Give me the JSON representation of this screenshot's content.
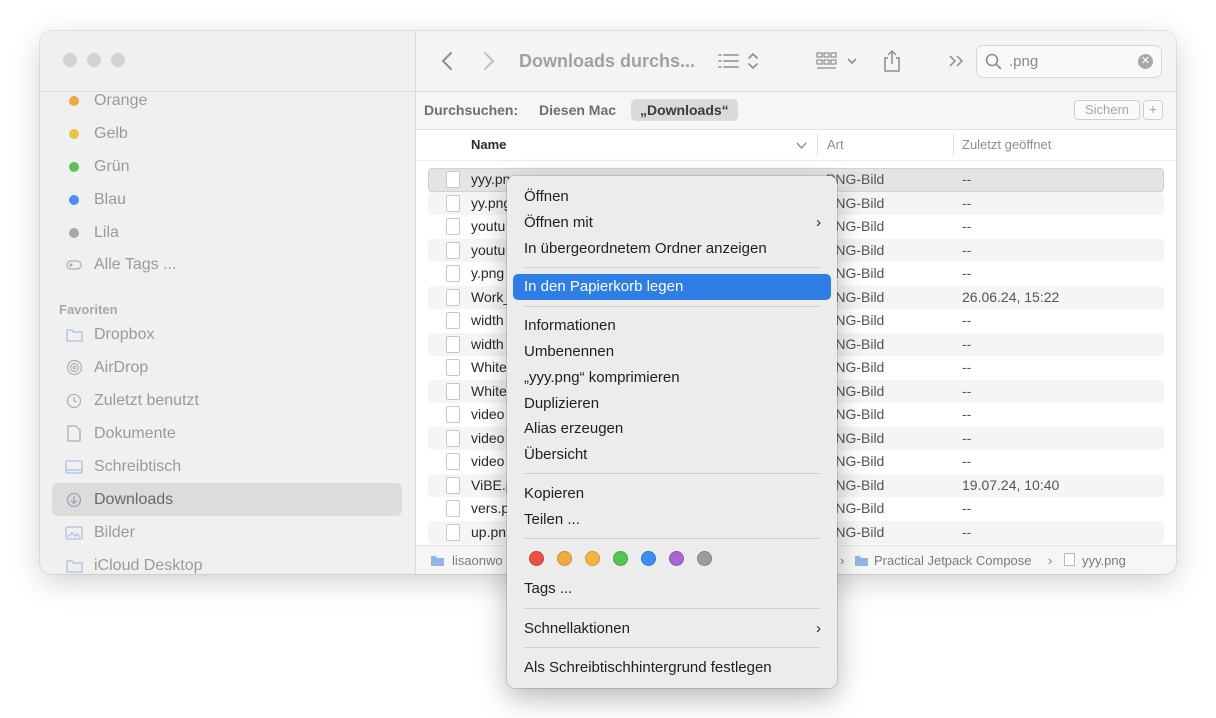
{
  "sidebar": {
    "tags": [
      {
        "label": "Orange",
        "color": "#f0a74a"
      },
      {
        "label": "Gelb",
        "color": "#e8c443"
      },
      {
        "label": "Grün",
        "color": "#5cbf5a"
      },
      {
        "label": "Blau",
        "color": "#4f8ef0"
      },
      {
        "label": "Lila",
        "color": "#a8a8a8"
      }
    ],
    "all_tags": "Alle Tags ...",
    "favorites_heading": "Favoriten",
    "favorites": [
      {
        "label": "Dropbox",
        "icon": "folder-icon"
      },
      {
        "label": "AirDrop",
        "icon": "airdrop-icon"
      },
      {
        "label": "Zuletzt benutzt",
        "icon": "clock-icon"
      },
      {
        "label": "Dokumente",
        "icon": "document-icon"
      },
      {
        "label": "Schreibtisch",
        "icon": "desktop-icon"
      },
      {
        "label": "Downloads",
        "icon": "download-icon"
      },
      {
        "label": "Bilder",
        "icon": "photo-icon"
      },
      {
        "label": "iCloud Desktop",
        "icon": "folder-icon"
      }
    ]
  },
  "toolbar": {
    "title": "Downloads durchs...",
    "search_value": ".png"
  },
  "scopebar": {
    "label": "Durchsuchen:",
    "this_mac": "Diesen Mac",
    "downloads": "„Downloads“",
    "save": "Sichern",
    "add": "+"
  },
  "columns": {
    "name": "Name",
    "kind": "Art",
    "opened": "Zuletzt geöffnet"
  },
  "files": [
    {
      "name": "yyy.png",
      "kind": "PNG-Bild",
      "opened": "--"
    },
    {
      "name": "yy.png",
      "kind": "PNG-Bild",
      "opened": "--"
    },
    {
      "name": "youtu",
      "kind": "PNG-Bild",
      "opened": "--"
    },
    {
      "name": "youtu",
      "kind": "PNG-Bild",
      "opened": "--"
    },
    {
      "name": "y.png",
      "kind": "PNG-Bild",
      "opened": "--"
    },
    {
      "name": "Work_",
      "kind": "PNG-Bild",
      "opened": "26.06.24, 15:22"
    },
    {
      "name": "width",
      "kind": "PNG-Bild",
      "opened": "--"
    },
    {
      "name": "width",
      "kind": "PNG-Bild",
      "opened": "--"
    },
    {
      "name": "White",
      "kind": "PNG-Bild",
      "opened": "--"
    },
    {
      "name": "White",
      "kind": "PNG-Bild",
      "opened": "--"
    },
    {
      "name": "video",
      "kind": "PNG-Bild",
      "opened": "--"
    },
    {
      "name": "video",
      "kind": "PNG-Bild",
      "opened": "--"
    },
    {
      "name": "video",
      "kind": "PNG-Bild",
      "opened": "--"
    },
    {
      "name": "ViBE.p",
      "kind": "PNG-Bild",
      "opened": "19.07.24, 10:40"
    },
    {
      "name": "vers.p",
      "kind": "PNG-Bild",
      "opened": "--"
    },
    {
      "name": "up.pn",
      "kind": "PNG-Bild",
      "opened": "--"
    }
  ],
  "pathbar": {
    "first": "lisaonwo",
    "folder": "Practical Jetpack Compose",
    "file": "yyy.png"
  },
  "context_menu": {
    "open": "Öffnen",
    "open_with": "Öffnen mit",
    "show_in_parent": "In übergeordnetem Ordner anzeigen",
    "move_to_trash": "In den Papierkorb legen",
    "info": "Informationen",
    "rename": "Umbenennen",
    "compress": "„yyy.png“ komprimieren",
    "duplicate": "Duplizieren",
    "alias": "Alias erzeugen",
    "quicklook": "Übersicht",
    "copy": "Kopieren",
    "share": "Teilen ...",
    "tags": "Tags ...",
    "quick_actions": "Schnellaktionen",
    "set_desktop": "Als Schreibtischhintergrund festlegen",
    "tag_colors": [
      "#ec5148",
      "#f4a93e",
      "#f5b43a",
      "#52c553",
      "#3d8ef2",
      "#a865d6",
      "#9c9c9c"
    ]
  }
}
